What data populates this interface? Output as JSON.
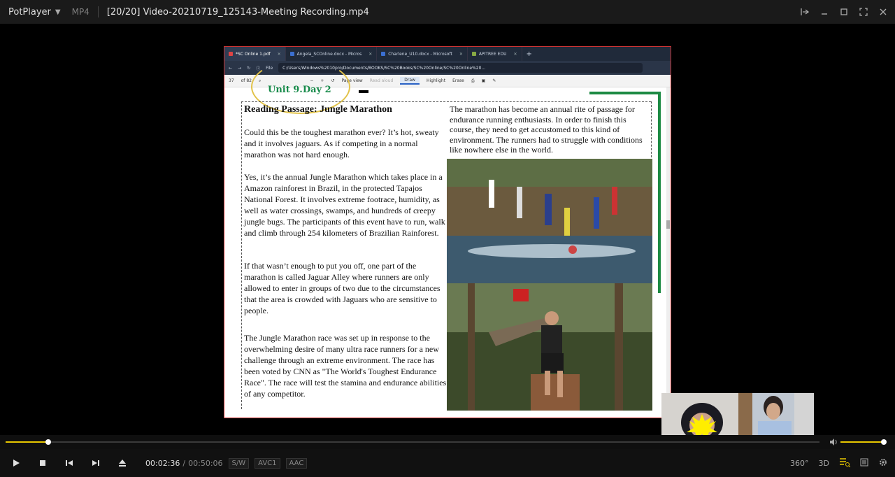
{
  "titlebar": {
    "app_name": "PotPlayer",
    "format": "MP4",
    "title": "[20/20] Video-20210719_125143-Meeting Recording.mp4"
  },
  "browser": {
    "tabs": [
      {
        "label": "*SC Online 1.pdf",
        "active": true
      },
      {
        "label": "Angela_SCOnline.docx - Micros",
        "active": false
      },
      {
        "label": "Charlene_U10.docx - Microsoft",
        "active": false
      },
      {
        "label": "APITREE EDU",
        "active": false
      }
    ],
    "new_tab": "+",
    "address_prefix": "File",
    "address": "C:/Users/Windows%2010pro/Documents/BOOKS/SC%20Books/SC%20Online/SC%20Online%20..."
  },
  "pdf_toolbar": {
    "page": "37",
    "page_total": "of 82",
    "page_view": "Page view",
    "read_aloud": "Read aloud",
    "draw": "Draw",
    "highlight": "Highlight",
    "erase": "Erase"
  },
  "document": {
    "unit_label": "Unit 9.Day 2",
    "heading": "Reading Passage: Jungle Marathon",
    "para1": "Could this be the toughest marathon ever? It’s hot, sweaty and it involves jaguars. As if competing in a normal marathon was not hard enough.",
    "para2": "Yes, it’s the annual Jungle Marathon which takes place in a Amazon rainforest in Brazil, in the protected Tapajos National Forest. It involves extreme footrace, humidity, as well as water crossings, swamps, and hundreds of creepy jungle bugs. The participants of this event have to run, walk and climb through 254 kilometers of Brazilian Rainforest.",
    "para3": "If that wasn’t enough to put you off, one part of the marathon is called Jaguar Alley where runners are only allowed to enter in groups of two due to the circumstances that the area is crowded with Jaguars who are sensitive to people.",
    "para4": "The Jungle Marathon race was set up in response to the overwhelming desire of many ultra race runners for a new challenge through an extreme environment. The race has been voted by CNN as \"The World's Toughest Endurance Race\". The race will test the stamina and endurance abilities of any competitor.",
    "para_right": "The marathon has become an annual rite of passage for endurance running enthusiasts. In order to finish this course, they need to get accustomed to this kind of environment. The runners had to struggle with conditions like nowhere else in the world."
  },
  "player": {
    "current_time": "00:02:36",
    "separator": "/",
    "duration": "00:50:06",
    "badges": [
      "S/W",
      "AVC1",
      "AAC"
    ],
    "progress_fraction": 0.052,
    "volume_fraction": 1.0,
    "right_controls": {
      "vr": "360°",
      "threed": "3D"
    }
  },
  "colors": {
    "accent": "#e8c700",
    "doc_green": "#178a4a",
    "screen_border": "#cc3333"
  }
}
